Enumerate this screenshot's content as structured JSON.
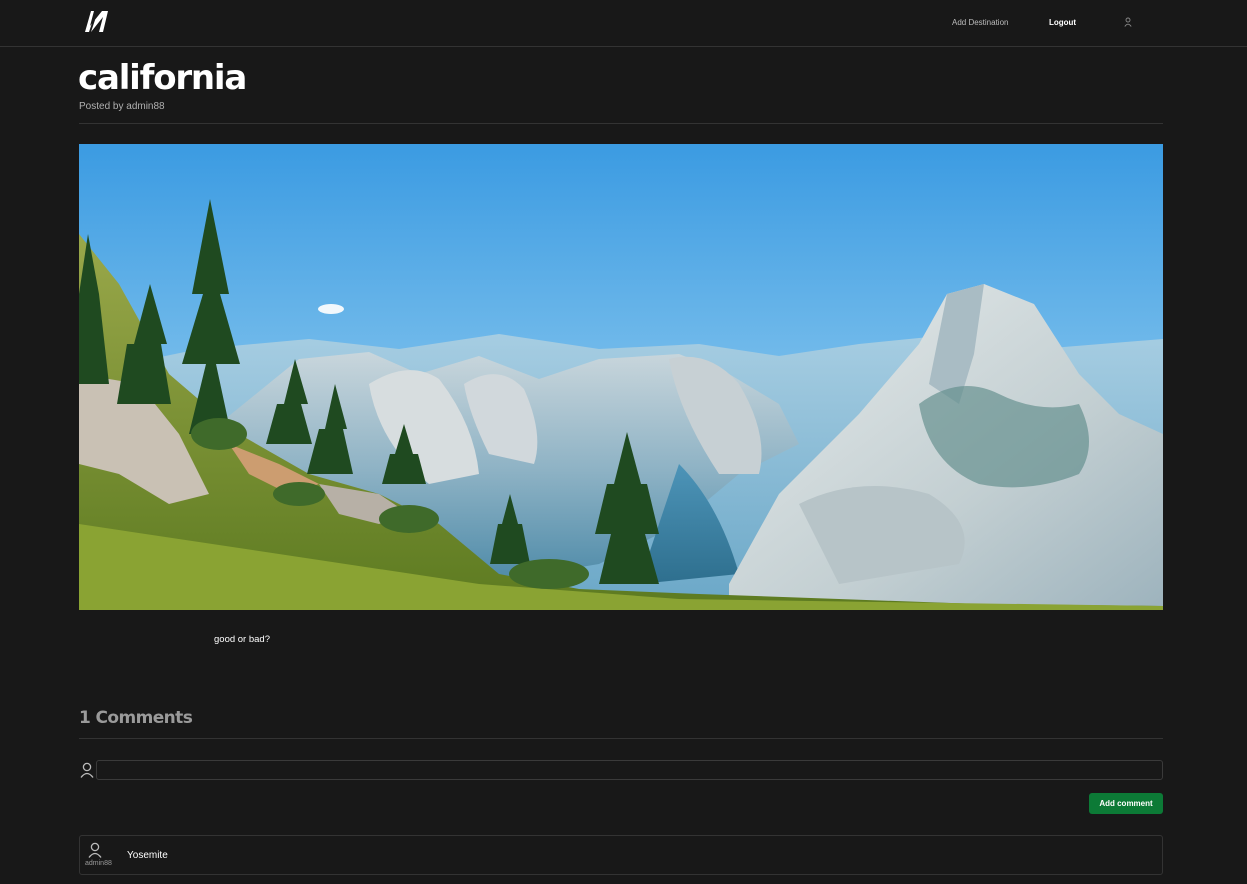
{
  "nav": {
    "logo": "n-logo-icon",
    "add_destination": "Add Destination",
    "logout": "Logout",
    "user_icon": "user-icon"
  },
  "post": {
    "title": "california",
    "posted_by": "Posted by admin88",
    "image": "yosemite-half-dome-landscape",
    "description": "good or bad?"
  },
  "comments": {
    "heading": "1 Comments",
    "input_value": "",
    "input_placeholder": "",
    "add_button": "Add comment",
    "items": [
      {
        "username": "admin88",
        "text": "Yosemite",
        "avatar": "user-icon"
      }
    ]
  },
  "colors": {
    "background": "#181818",
    "border": "#333333",
    "button": "#0c7a36",
    "muted": "#9a9a9a"
  }
}
